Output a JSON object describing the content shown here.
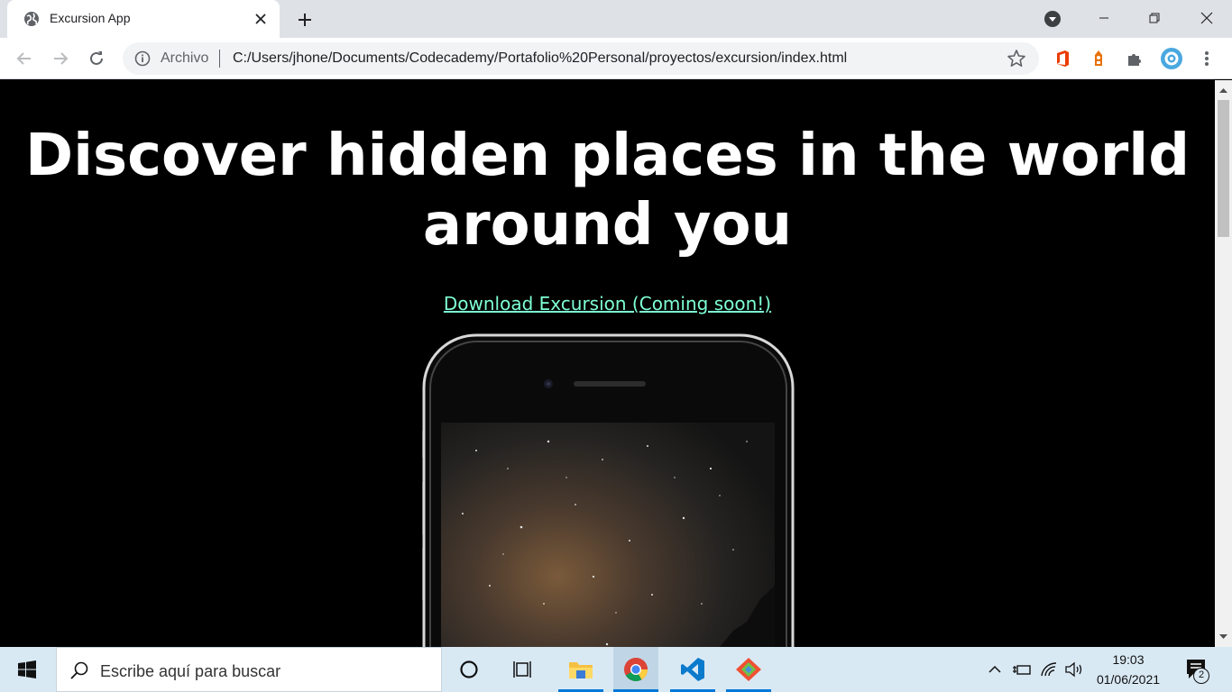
{
  "browser": {
    "tab_title": "Excursion App",
    "omnibox_scheme_label": "Archivo",
    "url": "C:/Users/jhone/Documents/Codecademy/Portafolio%20Personal/proyectos/excursion/index.html",
    "icons": [
      "globe-icon",
      "close-icon",
      "plus-icon",
      "back-icon",
      "forward-icon",
      "reload-icon",
      "info-icon",
      "star-icon",
      "office-icon",
      "extension-icon",
      "puzzle-icon",
      "profile-icon",
      "kebab-menu-icon"
    ]
  },
  "page": {
    "headline": "Discover hidden places in the world around you",
    "download_link": "Download Excursion (Coming soon!)",
    "accent_color": "#7fffd4"
  },
  "taskbar": {
    "search_placeholder": "Escribe aquí para buscar",
    "time": "19:03",
    "date": "01/06/2021",
    "notification_count": "2"
  }
}
